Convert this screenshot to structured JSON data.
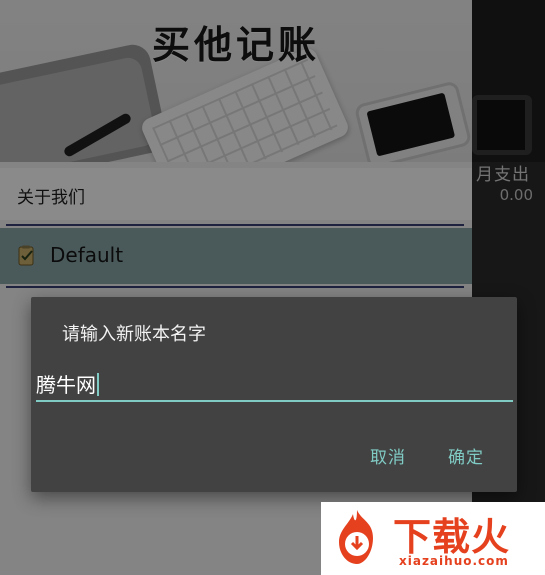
{
  "app": {
    "title": "买他记账"
  },
  "drawer": {
    "about_label": "关于我们",
    "ledger": {
      "name": "Default",
      "icon": "ledger-checklist-icon"
    }
  },
  "main": {
    "month_expense_label": "月支出",
    "month_expense_value": "0.00"
  },
  "dialog": {
    "title": "请输入新账本名字",
    "input_value": "腾牛网",
    "input_placeholder": "",
    "cancel_label": "取消",
    "ok_label": "确定"
  },
  "watermark": {
    "brand": "下载火",
    "domain": "xiazaihuo.com"
  },
  "colors": {
    "accent": "#80cbc4",
    "dialog_bg": "#424242",
    "divider": "#3a3f73",
    "selected_row": "#8aa6a8",
    "watermark": "#e5411f"
  }
}
